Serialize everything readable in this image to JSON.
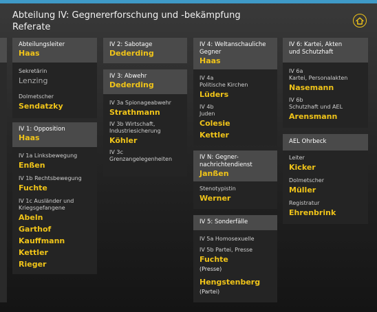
{
  "header": {
    "title_line1": "Abteilung IV: Gegnererforschung  und  -bekämpfung",
    "title_line2": "Referate"
  },
  "colors": {
    "accent": "#f0c419",
    "topline": "#3f9ac8",
    "panel": "#242424",
    "panel_header": "#4a4a4a"
  },
  "icons": {
    "home": "home-icon"
  },
  "col1": {
    "leitung": {
      "title": "Abteilungsleiter",
      "name": "Haas",
      "sekretaerin_label": "Sekretärin",
      "sekretaerin_name": "Lenzing",
      "dolmetscher_label": "Dolmetscher",
      "dolmetscher_name": "Sendatzky"
    },
    "iv1": {
      "title": "IV 1: Opposition",
      "name": "Haas",
      "iv1a_label": "IV 1a Linksbewegung",
      "iv1a_name": "Enßen",
      "iv1b_label": "IV 1b Rechtsbewegung",
      "iv1b_name": "Fuchte",
      "iv1c_label1": "IV 1c Ausländer und",
      "iv1c_label2": "Kriegsgefangene",
      "iv1c_names": [
        "Abeln",
        "Garthof",
        "Kauffmann",
        "Kettler",
        "Rieger"
      ]
    }
  },
  "col2": {
    "iv2": {
      "title": "IV 2: Sabotage",
      "name": "Dederding"
    },
    "iv3": {
      "title": "IV 3: Abwehr",
      "name": "Dederding",
      "iv3a_label": "IV 3a Spionageabwehr",
      "iv3a_name": "Strathmann",
      "iv3b_label1": "IV 3b Wirtschaft,",
      "iv3b_label2": "Industriesicherung",
      "iv3b_name": "Köhler",
      "iv3c_label1": "IV 3c",
      "iv3c_label2": "Grenzangelegenheiten"
    }
  },
  "col3": {
    "iv4": {
      "title1": "IV 4: Weltanschauliche",
      "title2": "Gegner",
      "name": "Haas",
      "iv4a_label1": "IV 4a",
      "iv4a_label2": "Politische Kirchen",
      "iv4a_name": "Lüders",
      "iv4b_label1": "IV 4b",
      "iv4b_label2": "Juden",
      "iv4b_names": [
        "Colesie",
        "Kettler"
      ]
    },
    "ivn": {
      "title1": "IV N: Gegner-",
      "title2": "nachrichtendienst",
      "name": "Janßen",
      "steno_label": "Stenotypistin",
      "steno_name": "Werner"
    },
    "iv5": {
      "title": "IV 5: Sonderfälle",
      "iv5a_label": "IV 5a Homosexuelle",
      "iv5b_label": "IV 5b Partei, Presse",
      "iv5b_name1": "Fuchte",
      "iv5b_note1": "(Presse)",
      "iv5b_name2": "Hengstenberg",
      "iv5b_note2": "(Partei)"
    }
  },
  "col4": {
    "iv6": {
      "title1": "IV 6: Kartei, Akten",
      "title2": "und Schutzhaft",
      "iv6a_label1": "IV 6a",
      "iv6a_label2": "Kartei, Personalakten",
      "iv6a_name": "Nasemann",
      "iv6b_label1": "IV 6b",
      "iv6b_label2": "Schutzhaft und AEL",
      "iv6b_name": "Arensmann"
    },
    "ael": {
      "title": "AEL Ohrbeck",
      "leiter_label": "Leiter",
      "leiter_name": "Kicker",
      "dolmetscher_label": "Dolmetscher",
      "dolmetscher_name": "Müller",
      "registratur_label": "Registratur",
      "registratur_name": "Ehrenbrink"
    }
  }
}
